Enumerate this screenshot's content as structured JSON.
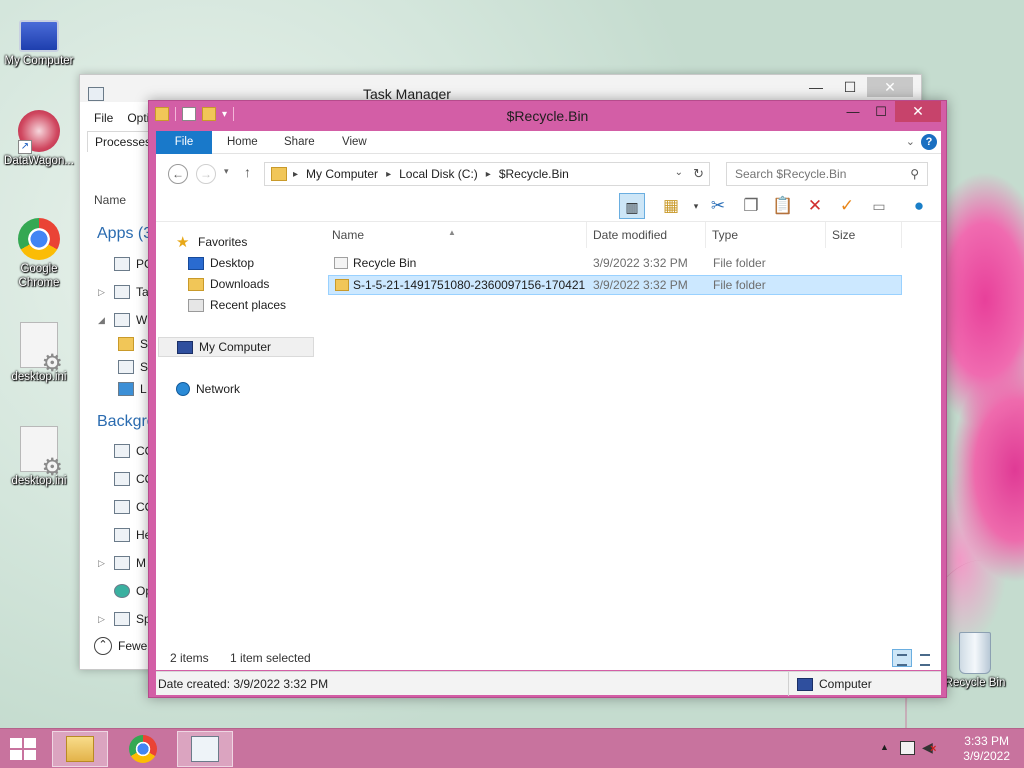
{
  "desktop": {
    "icons": [
      {
        "label": "My Computer",
        "icon": "computer-icon"
      },
      {
        "label": "DataWagon...",
        "icon": "datawagon-icon"
      },
      {
        "label": "Google Chrome",
        "icon": "chrome-icon"
      },
      {
        "label": "desktop.ini",
        "icon": "settings-file-icon"
      },
      {
        "label": "desktop.ini",
        "icon": "settings-file-icon"
      },
      {
        "label": "Recycle Bin",
        "icon": "recycle-bin-icon"
      }
    ]
  },
  "task_manager": {
    "title": "Task Manager",
    "menu": [
      "File",
      "Opti"
    ],
    "tab_processes": "Processes",
    "column_name": "Name",
    "section_apps": "Apps (3",
    "section_background": "Backgro",
    "rows": [
      "PC",
      "Ta",
      "W",
      "S",
      "S",
      "L",
      "CO",
      "CO",
      "CO",
      "He",
      "M",
      "Op",
      "Sp"
    ],
    "fewer_details": "Fewe"
  },
  "explorer": {
    "title": "$Recycle.Bin",
    "ribbon_tabs": [
      "File",
      "Home",
      "Share",
      "View"
    ],
    "address": {
      "crumbs": [
        "My Computer",
        "Local Disk (C:)",
        "$Recycle.Bin"
      ]
    },
    "search_placeholder": "Search $Recycle.Bin",
    "nav": {
      "favorites": "Favorites",
      "desktop": "Desktop",
      "downloads": "Downloads",
      "recent": "Recent places",
      "my_computer": "My Computer",
      "network": "Network"
    },
    "columns": {
      "name": "Name",
      "date": "Date modified",
      "type": "Type",
      "size": "Size"
    },
    "files": [
      {
        "name": "Recycle Bin",
        "date": "3/9/2022 3:32 PM",
        "type": "File folder",
        "size": "",
        "selected": false,
        "icon": "recycle-bin-icon"
      },
      {
        "name": "S-1-5-21-1491751080-2360097156-170421...",
        "date": "3/9/2022 3:32 PM",
        "type": "File folder",
        "size": "",
        "selected": true,
        "icon": "folder-icon"
      }
    ],
    "status": {
      "item_count": "2 items",
      "selection": "1 item selected"
    },
    "details": {
      "date_created": "Date created: 3/9/2022 3:32 PM",
      "zone": "Computer"
    }
  },
  "taskbar": {
    "apps": [
      {
        "name": "File Explorer",
        "icon": "file-explorer-icon",
        "active": true
      },
      {
        "name": "Google Chrome",
        "icon": "chrome-icon",
        "active": false
      },
      {
        "name": "Task Manager",
        "icon": "task-manager-icon",
        "active": true
      }
    ],
    "time": "3:33 PM",
    "date": "3/9/2022"
  }
}
